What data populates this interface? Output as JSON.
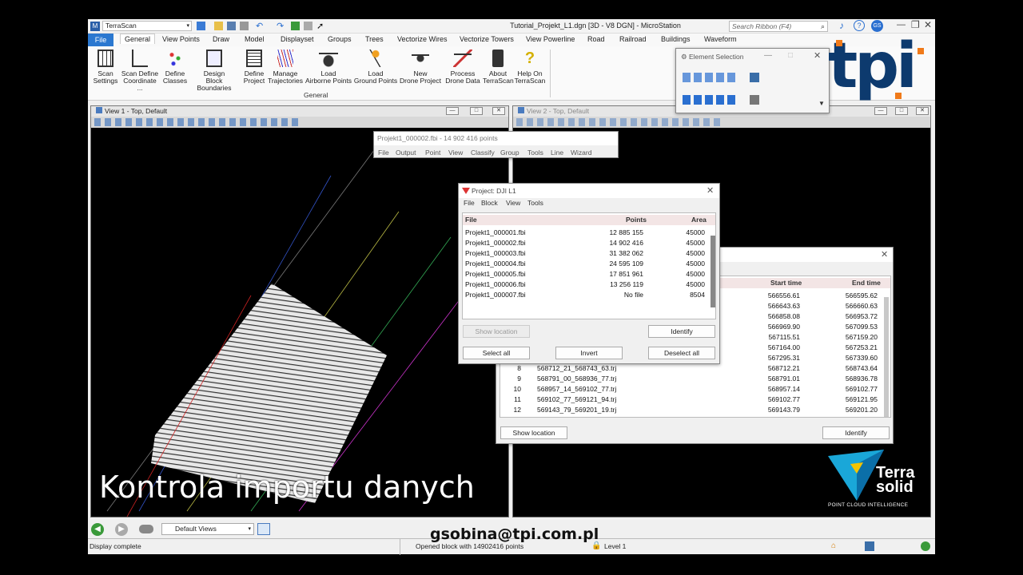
{
  "app": {
    "workspace": "TerraScan",
    "window_title": "Tutorial_Projekt_L1.dgn [3D - V8 DGN] - MicroStation",
    "search_placeholder": "Search Ribbon (F4)",
    "user_badge": "GS"
  },
  "ribbon": {
    "tabs": [
      "File",
      "General",
      "View Points",
      "Draw",
      "Model",
      "Displayset",
      "Groups",
      "Trees",
      "Vectorize Wires",
      "Vectorize Towers",
      "View Powerline",
      "Road",
      "Railroad",
      "Buildings",
      "Waveform"
    ],
    "active_tab": "General",
    "group_label": "General",
    "buttons": [
      {
        "line1": "Scan",
        "line2": "Settings"
      },
      {
        "line1": "Scan Define",
        "line2": "Coordinate ..."
      },
      {
        "line1": "Define",
        "line2": "Classes"
      },
      {
        "line1": "Design",
        "line2": "Block Boundaries"
      },
      {
        "line1": "Define",
        "line2": "Project"
      },
      {
        "line1": "Manage",
        "line2": "Trajectories"
      },
      {
        "line1": "Load",
        "line2": "Airborne Points"
      },
      {
        "line1": "Load",
        "line2": "Ground Points"
      },
      {
        "line1": "New",
        "line2": "Drone Project"
      },
      {
        "line1": "Process",
        "line2": "Drone Data"
      },
      {
        "line1": "About",
        "line2": "TerraScan"
      },
      {
        "line1": "Help On",
        "line2": "TerraScan"
      }
    ]
  },
  "element_selection": {
    "title": "Element Selection"
  },
  "view1": {
    "title": "View 1 - Top, Default"
  },
  "view2": {
    "title": "View 2 - Top, Default"
  },
  "points_window": {
    "title": "Projekt1_000002.fbi - 14 902 416 points",
    "menu": [
      "File",
      "Output",
      "Point",
      "View",
      "Classify",
      "Group",
      "Tools",
      "Line",
      "Wizard"
    ]
  },
  "project_dialog": {
    "title": "Project: DJI L1",
    "menu": [
      "File",
      "Block",
      "View",
      "Tools"
    ],
    "columns": [
      "File",
      "Points",
      "Area"
    ],
    "rows": [
      {
        "file": "Projekt1_000001.fbi",
        "points": "12 885 155",
        "area": "45000"
      },
      {
        "file": "Projekt1_000002.fbi",
        "points": "14 902 416",
        "area": "45000"
      },
      {
        "file": "Projekt1_000003.fbi",
        "points": "31 382 062",
        "area": "45000"
      },
      {
        "file": "Projekt1_000004.fbi",
        "points": "24 595 109",
        "area": "45000"
      },
      {
        "file": "Projekt1_000005.fbi",
        "points": "17 851 961",
        "area": "45000"
      },
      {
        "file": "Projekt1_000006.fbi",
        "points": "13 256 119",
        "area": "45000"
      },
      {
        "file": "Projekt1_000007.fbi",
        "points": "No file",
        "area": "8504"
      }
    ],
    "buttons": {
      "show_location": "Show location",
      "identify": "Identify",
      "select_all": "Select all",
      "invert": "Invert",
      "deselect_all": "Deselect all"
    }
  },
  "trajectories_dialog": {
    "columns": [
      "Start time",
      "End time"
    ],
    "rows_top": [
      {
        "start": "566556.61",
        "end": "566595.62"
      },
      {
        "start": "566643.63",
        "end": "566660.63"
      },
      {
        "start": "566858.08",
        "end": "566953.72"
      },
      {
        "start": "566969.90",
        "end": "567099.53"
      },
      {
        "start": "567115.51",
        "end": "567159.20"
      },
      {
        "start": "567164.00",
        "end": "567253.21"
      },
      {
        "start": "567295.31",
        "end": "567339.60"
      }
    ],
    "rows_named": [
      {
        "num": "8",
        "name": "568712_21_568743_63.trj",
        "start": "568712.21",
        "end": "568743.64"
      },
      {
        "num": "9",
        "name": "568791_00_568936_77.trj",
        "start": "568791.01",
        "end": "568936.78"
      },
      {
        "num": "10",
        "name": "568957_14_569102_77.trj",
        "start": "568957.14",
        "end": "569102.77"
      },
      {
        "num": "11",
        "name": "569102_77_569121_94.trj",
        "start": "569102.77",
        "end": "569121.95"
      },
      {
        "num": "12",
        "name": "569143_79_569201_19.trj",
        "start": "569143.79",
        "end": "569201.20"
      }
    ],
    "buttons": {
      "show_location": "Show location",
      "identify": "Identify"
    }
  },
  "bottom_bar": {
    "views_select": "Default Views",
    "status_left": "Display complete",
    "status_mid": "Opened block with 14902416 points",
    "level": "Level 1"
  },
  "overlay": {
    "caption": "Kontrola importu danych",
    "email": "gsobina@tpi.com.pl",
    "tpi_logo": "tpi",
    "terrasolid_line1": "Terra",
    "terrasolid_line2": "solid",
    "terrasolid_tagline": "POINT CLOUD INTELLIGENCE"
  },
  "colors": {
    "file_tab": "#2b78d0",
    "tpi_blue": "#0d3a6e",
    "tpi_orange": "#f07a1a",
    "terrasolid_cyan": "#1aa7d8",
    "terrasolid_yellow": "#f4c400"
  }
}
